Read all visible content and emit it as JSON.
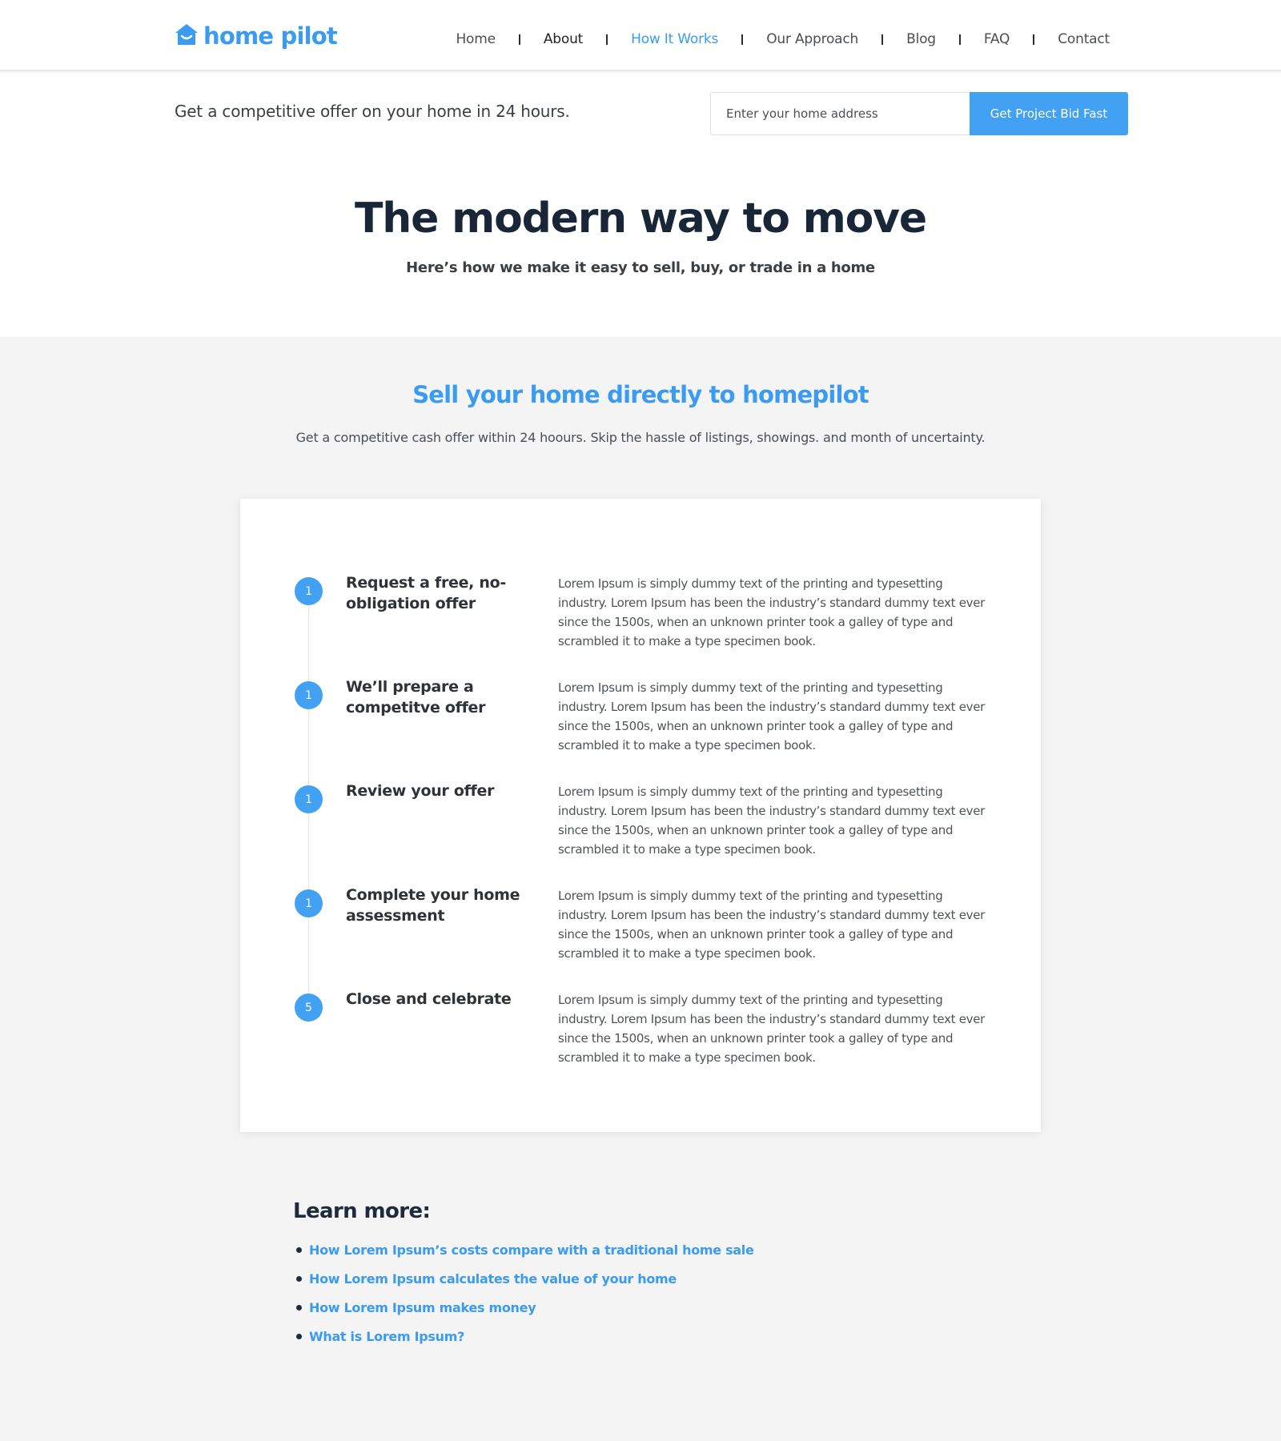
{
  "brand": {
    "name": "home pilot",
    "color": "#3a9bf0",
    "icon": "house-smile-icon"
  },
  "nav": {
    "items": [
      {
        "label": "Home"
      },
      {
        "label": "About"
      },
      {
        "label": "How It Works"
      },
      {
        "label": "Our Approach"
      },
      {
        "label": "Blog"
      },
      {
        "label": "FAQ"
      },
      {
        "label": "Contact"
      }
    ],
    "active": "How It Works"
  },
  "offer": {
    "tagline": "Get a competitive offer on your home in 24 hours.",
    "address_placeholder": "Enter your home address",
    "address_value": "",
    "button_label": "Get Project Bid Fast"
  },
  "hero": {
    "title": "The modern way to move",
    "subtitle": "Here’s how we make it easy to sell, buy, or trade in a home"
  },
  "sell": {
    "title": "Sell your home directly to homepilot",
    "subtitle": "Get a competitive cash offer within 24 hoours. Skip the hassle of listings, showings. and month of uncertainty."
  },
  "steps": [
    {
      "number": "1",
      "title": "Request a free, no-obligation offer",
      "description": "Lorem Ipsum is simply dummy text of the printing and typesetting industry. Lorem Ipsum has been the industry’s standard dummy text ever since the 1500s, when an unknown printer took a galley of type and scrambled it to make a type specimen book."
    },
    {
      "number": "1",
      "title": "We’ll prepare a competitve offer",
      "description": "Lorem Ipsum is simply dummy text of the printing and typesetting industry. Lorem Ipsum has been the industry’s standard dummy text ever since the 1500s, when an unknown printer took a galley of type and scrambled it to make a type specimen book."
    },
    {
      "number": "1",
      "title": "Review your offer",
      "description": "Lorem Ipsum is simply dummy text of the printing and typesetting industry. Lorem Ipsum has been the industry’s standard dummy text ever since the 1500s, when an unknown printer took a galley of type and scrambled it to make a type specimen book."
    },
    {
      "number": "1",
      "title": "Complete your home assessment",
      "description": "Lorem Ipsum is simply dummy text of the printing and typesetting industry. Lorem Ipsum has been the industry’s standard dummy text ever since the 1500s, when an unknown printer took a galley of type and scrambled it to make a type specimen book."
    },
    {
      "number": "5",
      "title": "Close and celebrate",
      "description": "Lorem Ipsum is simply dummy text of the printing and typesetting industry. Lorem Ipsum has been the industry’s standard dummy text ever since the 1500s, when an unknown printer took a galley of type and scrambled it to make a type specimen book."
    }
  ],
  "learn_more": {
    "title": "Learn more:",
    "links": [
      {
        "label": "How Lorem Ipsum’s costs compare with a traditional home sale"
      },
      {
        "label": "How Lorem Ipsum calculates the value of your home"
      },
      {
        "label": "How Lorem Ipsum makes money"
      },
      {
        "label": "What is Lorem Ipsum?"
      }
    ]
  },
  "colors": {
    "accent": "#43a1f4",
    "heading": "#182638",
    "page_bg": "#f4f4f4"
  }
}
